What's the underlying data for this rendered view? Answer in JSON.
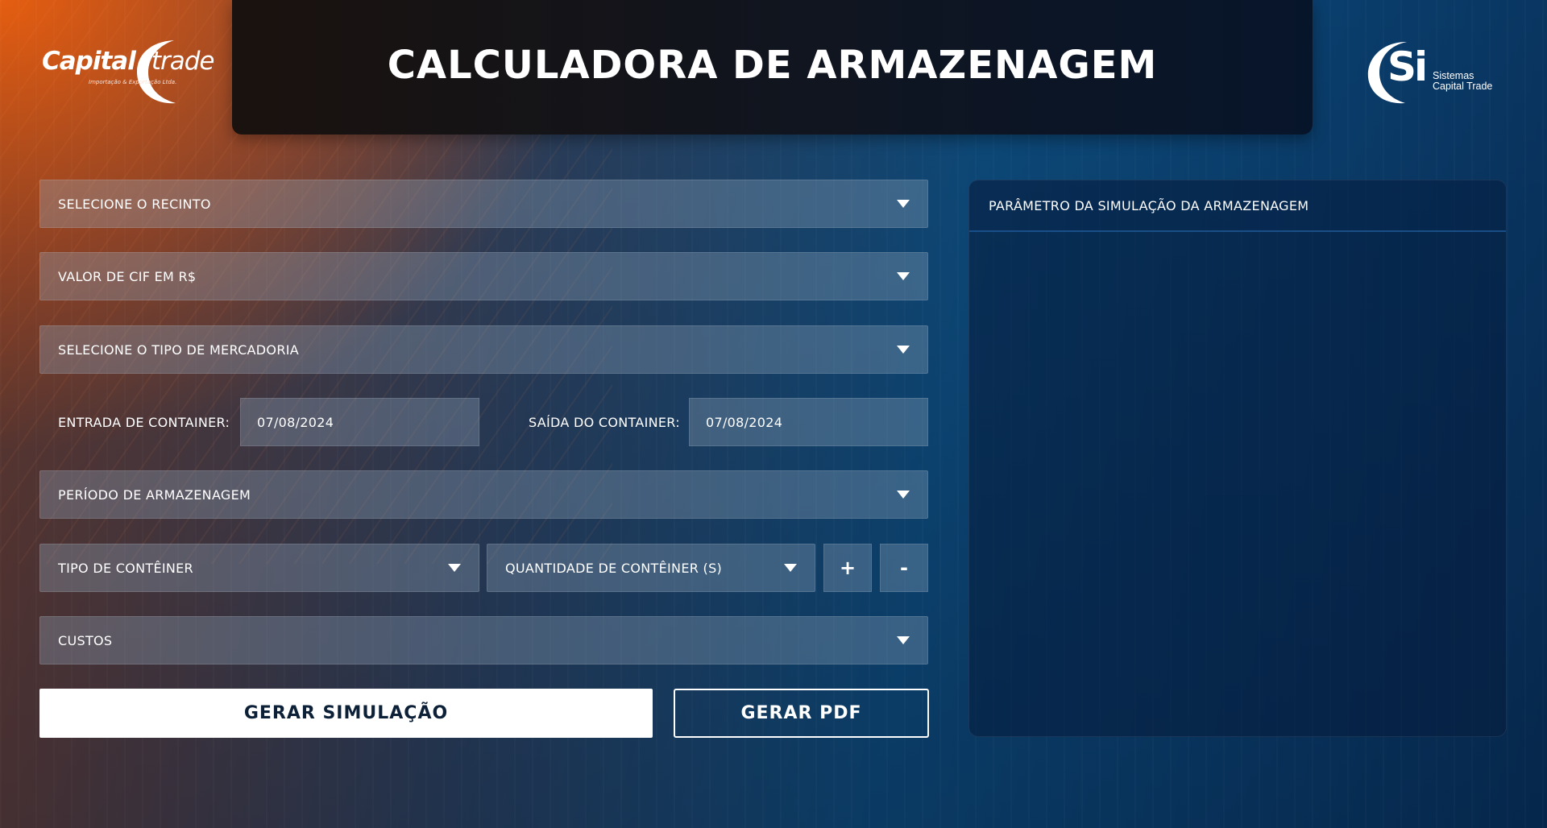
{
  "header": {
    "title": "CALCULADORA DE ARMAZENAGEM"
  },
  "logos": {
    "left": {
      "brand_a": "Capital",
      "brand_b": "trade",
      "tagline": "Importação & Exportação Ltda."
    },
    "right": {
      "mark": "Si",
      "line1": "Sistemas",
      "line2": "Capital Trade"
    }
  },
  "form": {
    "recinto": "SELECIONE O RECINTO",
    "cif": "VALOR DE CIF EM R$",
    "mercadoria": "SELECIONE O TIPO DE MERCADORIA",
    "entrada_label": "ENTRADA DE CONTAINER:",
    "entrada_value": "07/08/2024",
    "saida_label": "SAÍDA DO CONTAINER:",
    "saida_value": "07/08/2024",
    "periodo": "PERÍODO DE ARMAZENAGEM",
    "tipo_conteiner": "TIPO DE CONTÊINER",
    "quantidade": "QUANTIDADE DE CONTÊINER (S)",
    "plus": "+",
    "minus": "-",
    "custos": "CUSTOS"
  },
  "actions": {
    "simulate": "GERAR SIMULAÇÃO",
    "pdf": "GERAR PDF"
  },
  "panel": {
    "title": "PARÂMETRO DA SIMULAÇÃO DA ARMAZENAGEM"
  },
  "colors": {
    "accent_orange": "#E8600F",
    "deep_blue": "#0A3D6B",
    "button_text": "#0C2038"
  },
  "icons": [
    "caret-down-icon",
    "plus-icon",
    "minus-icon",
    "capital-trade-logo",
    "si-logo"
  ]
}
